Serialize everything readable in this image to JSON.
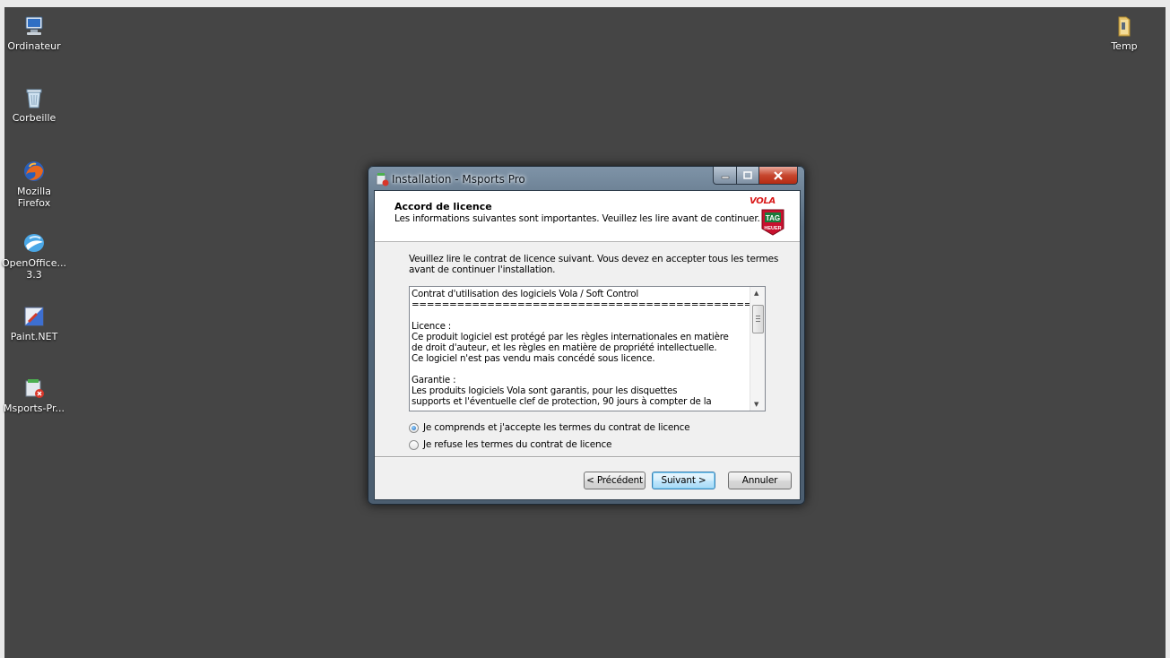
{
  "desktop": {
    "icons_left": [
      {
        "label": "Ordinateur",
        "icon": "computer-icon"
      },
      {
        "label": "Corbeille",
        "icon": "recycle-bin-icon"
      },
      {
        "label": "Mozilla\nFirefox",
        "icon": "firefox-icon"
      },
      {
        "label": "OpenOffice...\n3.3",
        "icon": "openoffice-icon"
      },
      {
        "label": "Paint.NET",
        "icon": "paintnet-icon"
      },
      {
        "label": "Msports-Pr...",
        "icon": "installer-icon"
      }
    ],
    "icon_right": {
      "label": "Temp",
      "icon": "folder-icon"
    }
  },
  "window": {
    "title": "Installation - Msports Pro",
    "header_title": "Accord de licence",
    "header_subtitle": "Les informations suivantes sont importantes. Veuillez les lire avant de continuer.",
    "logo_text": "VOLA",
    "logo_badge": "TAG HEUER",
    "intro_lines": [
      "Veuillez lire le contrat de licence suivant. Vous devez en accepter tous les termes",
      "avant de continuer l'installation."
    ],
    "license_lines": [
      "Contrat d'utilisation des logiciels Vola / Soft Control",
      "================================================",
      "",
      "Licence :",
      "Ce produit logiciel est protégé par les règles internationales en matière",
      "de droit d'auteur, et les règles en matière de propriété intellectuelle.",
      "Ce logiciel n'est pas vendu mais concédé sous licence.",
      "",
      "Garantie :",
      "Les produits logiciels Vola sont garantis, pour les disquettes",
      "supports et l'éventuelle clef de protection, 90 jours à compter de la"
    ],
    "accept_label": "Je comprends et j'accepte les termes du contrat de licence",
    "refuse_label": "Je refuse les termes du contrat de licence",
    "accept_selected": true,
    "buttons": {
      "back": "< Précédent",
      "next": "Suivant >",
      "cancel": "Annuler"
    }
  }
}
